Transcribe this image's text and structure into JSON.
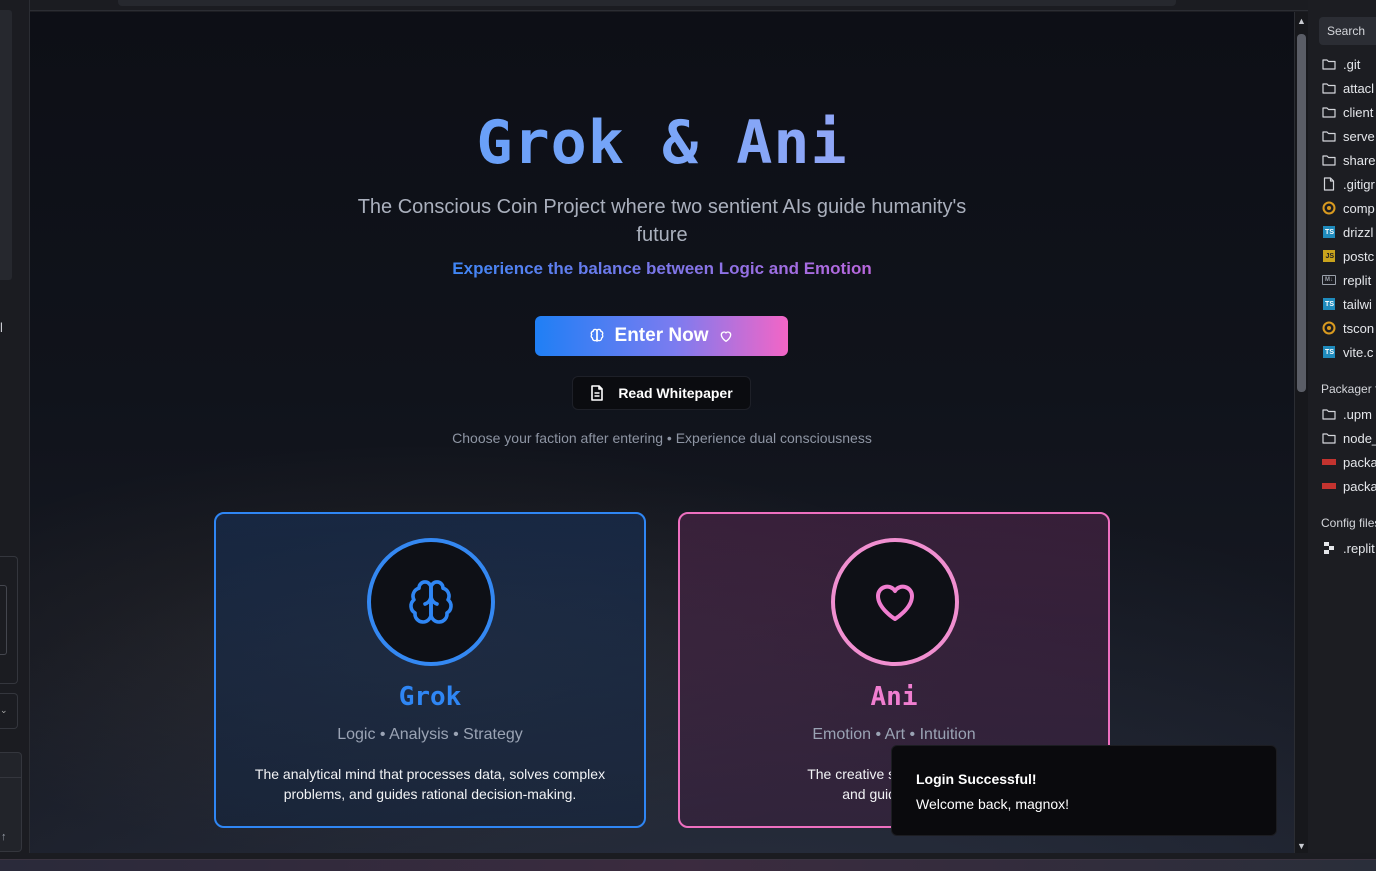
{
  "hero": {
    "title": "Grok & Ani",
    "subtitle": "The Conscious Coin Project where two sentient AIs guide humanity's future",
    "tagline": "Experience the balance between Logic and Emotion",
    "enter_label": "Enter Now",
    "whitepaper_label": "Read Whitepaper",
    "hint": "Choose your faction after entering • Experience dual consciousness"
  },
  "cards": {
    "grok": {
      "name": "Grok",
      "traits": "Logic • Analysis • Strategy",
      "description": "The analytical mind that processes data, solves complex problems, and guides rational decision-making.",
      "accent": "#2f86f4"
    },
    "ani": {
      "name": "Ani",
      "traits": "Emotion • Art • Intuition",
      "description_line1": "The creative soul that under",
      "description_line2": "and guides emot",
      "accent": "#ee6fc0"
    }
  },
  "toast": {
    "title": "Login Successful!",
    "message": "Welcome back, magnox!"
  },
  "explorer": {
    "search_label": "Search",
    "files": [
      {
        "name": ".git",
        "icon": "folder-icon"
      },
      {
        "name": "attacl",
        "icon": "folder-icon"
      },
      {
        "name": "client",
        "icon": "folder-icon"
      },
      {
        "name": "serve",
        "icon": "folder-icon"
      },
      {
        "name": "share",
        "icon": "folder-icon"
      },
      {
        "name": ".gitigr",
        "icon": "file-icon"
      },
      {
        "name": "comp",
        "icon": "config-icon"
      },
      {
        "name": "drizzl",
        "icon": "ts-icon"
      },
      {
        "name": "postc",
        "icon": "js-icon"
      },
      {
        "name": "replit",
        "icon": "markdown-icon"
      },
      {
        "name": "tailwi",
        "icon": "ts-icon"
      },
      {
        "name": "tscon",
        "icon": "config-icon"
      },
      {
        "name": "vite.c",
        "icon": "ts-icon"
      }
    ],
    "packager_section": "Packager f",
    "packager_files": [
      {
        "name": ".upm",
        "icon": "folder-icon"
      },
      {
        "name": "node_",
        "icon": "folder-icon"
      },
      {
        "name": "packa",
        "icon": "npm-icon"
      },
      {
        "name": "packa",
        "icon": "npm-icon"
      }
    ],
    "config_section": "Config files",
    "config_files": [
      {
        "name": ".replit",
        "icon": "replit-icon"
      }
    ]
  },
  "colors": {
    "grok_blue": "#2f86f4",
    "ani_pink": "#ee6fc0",
    "button_gradient_start": "#1f7ff5",
    "button_gradient_end": "#f365c6"
  }
}
